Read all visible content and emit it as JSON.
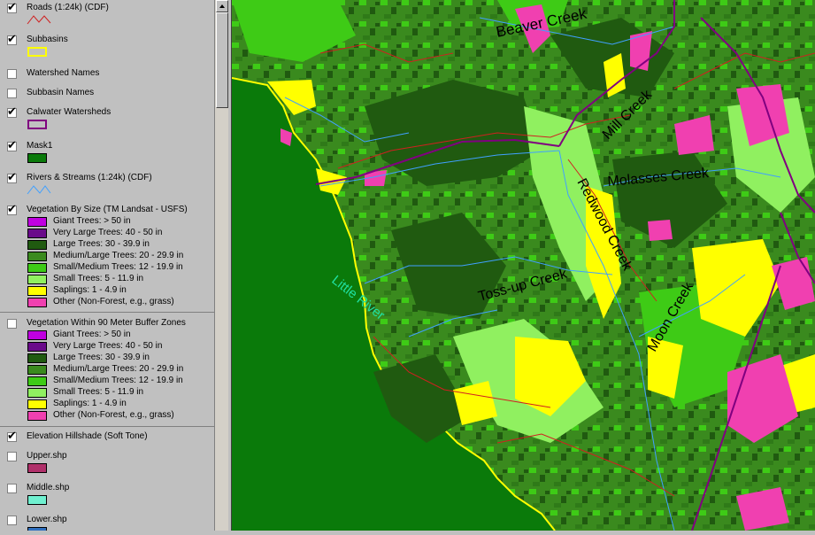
{
  "legend": {
    "roads": {
      "label": "Roads (1:24k) (CDF)",
      "checked": true
    },
    "subbasins": {
      "label": "Subbasins",
      "checked": true
    },
    "watershed_names": {
      "label": "Watershed Names",
      "checked": false
    },
    "subbasin_names": {
      "label": "Subbasin Names",
      "checked": false
    },
    "calwater": {
      "label": "Calwater Watersheds",
      "checked": true
    },
    "mask": {
      "label": "Mask1",
      "checked": true
    },
    "rivers": {
      "label": "Rivers & Streams (1:24k) (CDF)",
      "checked": true
    },
    "veg_size": {
      "label": "Vegetation By Size (TM Landsat - USFS)",
      "checked": true,
      "classes": [
        {
          "label": "Giant Trees: > 50 in",
          "color": "#c000e0"
        },
        {
          "label": "Very Large Trees: 40 - 50 in",
          "color": "#6a0a8a"
        },
        {
          "label": "Large Trees: 30 - 39.9 in",
          "color": "#205a10"
        },
        {
          "label": "Medium/Large Trees: 20 - 29.9 in",
          "color": "#3a8a1e"
        },
        {
          "label": "Small/Medium Trees: 12 - 19.9 in",
          "color": "#3ecb16"
        },
        {
          "label": "Small Trees: 5 - 11.9 in",
          "color": "#90f060"
        },
        {
          "label": "Saplings: 1 - 4.9 in",
          "color": "#ffff00"
        },
        {
          "label": "Other (Non-Forest, e.g., grass)",
          "color": "#f040b0"
        }
      ]
    },
    "veg_buffer": {
      "label": "Vegetation Within 90 Meter Buffer Zones",
      "checked": false,
      "classes": [
        {
          "label": "Giant Trees: > 50 in",
          "color": "#c000e0"
        },
        {
          "label": "Very Large Trees: 40 - 50 in",
          "color": "#6a0a8a"
        },
        {
          "label": "Large Trees: 30 - 39.9 in",
          "color": "#205a10"
        },
        {
          "label": "Medium/Large Trees: 20 - 29.9 in",
          "color": "#3a8a1e"
        },
        {
          "label": "Small/Medium Trees: 12 - 19.9 in",
          "color": "#3ecb16"
        },
        {
          "label": "Small Trees: 5 - 11.9 in",
          "color": "#90f060"
        },
        {
          "label": "Saplings: 1 - 4.9 in",
          "color": "#ffff00"
        },
        {
          "label": "Other (Non-Forest, e.g., grass)",
          "color": "#f040b0"
        }
      ]
    },
    "hillshade": {
      "label": "Elevation Hillshade (Soft Tone)",
      "checked": true
    },
    "upper": {
      "label": "Upper.shp",
      "checked": false,
      "color": "#b0306a"
    },
    "middle": {
      "label": "Middle.shp",
      "checked": false,
      "color": "#70f0d0"
    },
    "lower": {
      "label": "Lower.shp",
      "checked": false,
      "color": "#3070c0"
    }
  },
  "map": {
    "labels": {
      "beaver": "Beaver Creek",
      "mill": "Mill Creek",
      "molasses": "Molasses Creek",
      "redwood": "Redwood Creek",
      "tossup": "Toss-up Creek",
      "moon": "Moon Creek",
      "little_river": "Little River"
    },
    "colors": {
      "ocean": "#0a7a0a",
      "medium_large": "#3a8a1e",
      "large": "#205a10",
      "small_medium": "#3ecb16",
      "small": "#90f060",
      "saplings": "#ffff00",
      "other": "#f040b0",
      "river": "#40a0ff",
      "road": "#d02020",
      "boundary": "#800080"
    }
  }
}
